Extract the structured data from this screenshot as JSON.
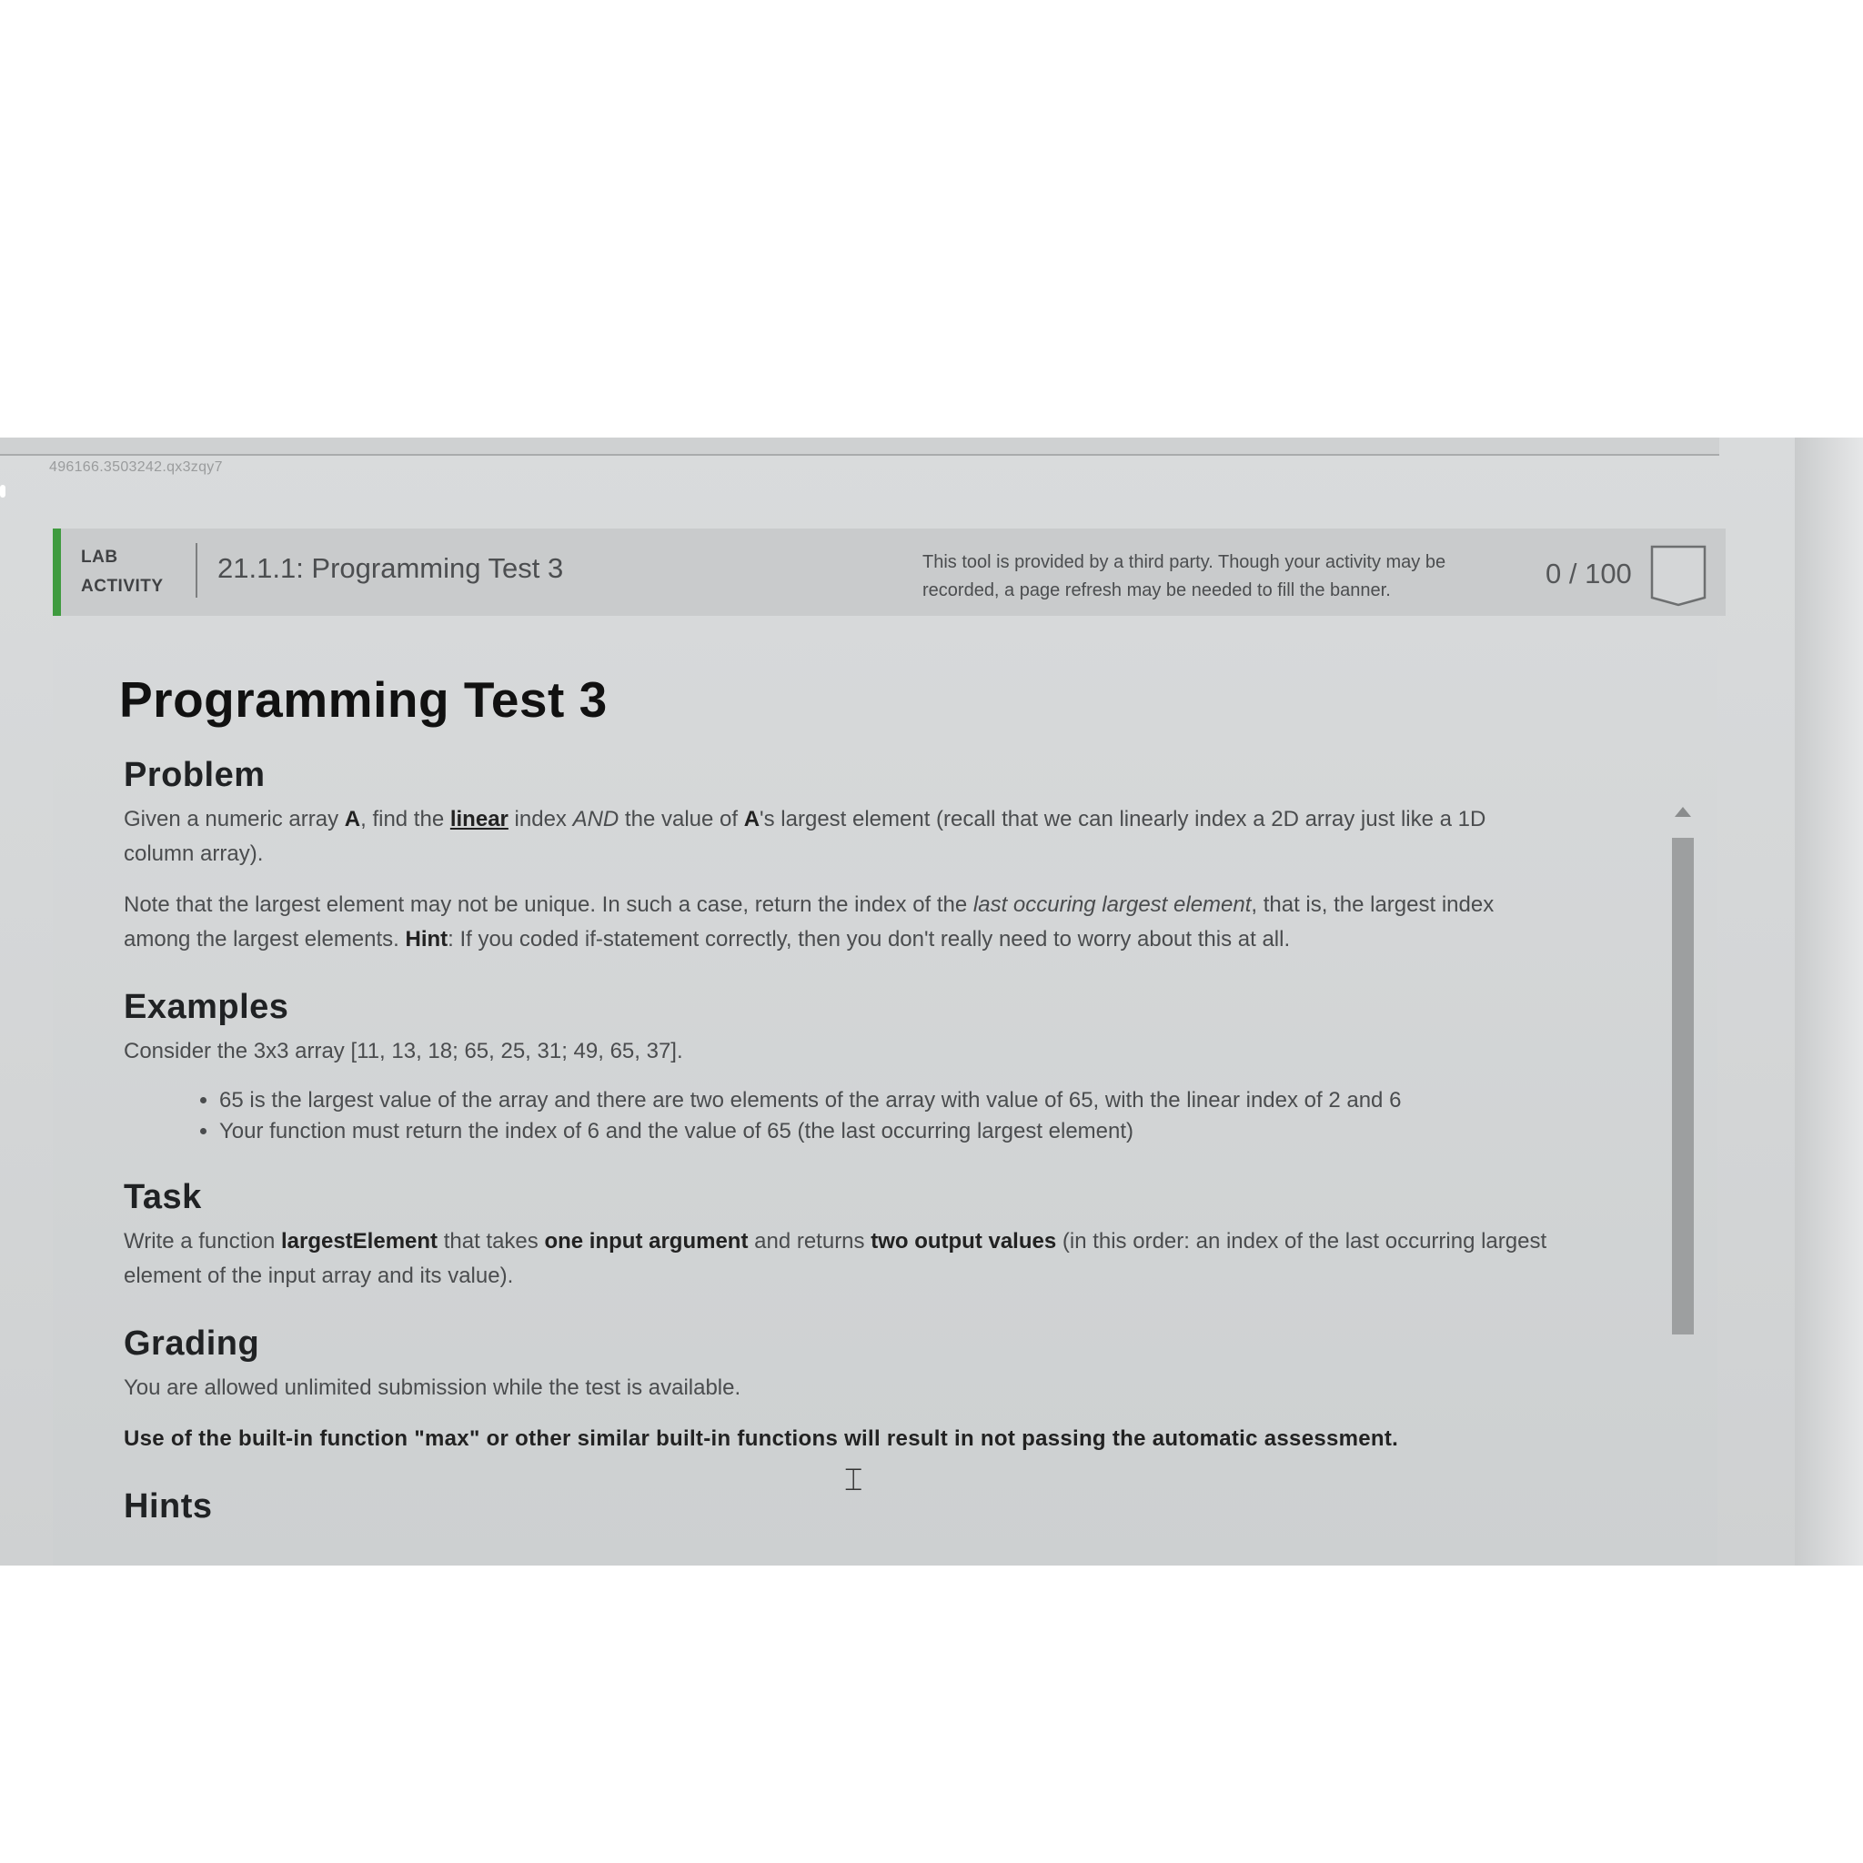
{
  "session_id": "496166.3503242.qx3zqy7",
  "banner": {
    "lab_line1": "LAB",
    "lab_line2": "ACTIVITY",
    "activity_title": "21.1.1: Programming Test 3",
    "notice_line1": "This tool is provided by a third party. Though your activity may be",
    "notice_line2": "recorded, a page refresh may be needed to fill the banner.",
    "score": "0 / 100"
  },
  "content": {
    "title": "Programming Test 3",
    "problem": {
      "heading": "Problem",
      "p1": {
        "t1": "Given a numeric array ",
        "b1": "A",
        "t2": ", find the ",
        "b2": "linear",
        "t3": " index ",
        "i1": "AND",
        "t4": " the value of ",
        "b3": "A",
        "t5": "'s largest element (recall that we can linearly index a 2D array just like a 1D column array)."
      },
      "p2": {
        "t1": "Note that the largest element may not be unique. In such a case, return the index of the ",
        "i1": "last occuring largest element",
        "t2": ", that is, the largest index among the largest elements. ",
        "b1": "Hint",
        "t3": ": If you coded if-statement correctly, then you don't really need to worry about this at all."
      }
    },
    "examples": {
      "heading": "Examples",
      "intro": "Consider the 3x3 array [11, 13, 18; 65, 25, 31; 49, 65, 37].",
      "bullets": [
        "65 is the largest value of the array and there are two elements of the array with value of 65, with the linear index of 2 and 6",
        "Your function must return the index of 6 and the value of 65 (the last occurring largest element)"
      ]
    },
    "task": {
      "heading": "Task",
      "t1": "Write a function ",
      "b1": "largestElement",
      "t2": " that takes ",
      "b2": "one input argument",
      "t3": " and returns ",
      "b3": "two output values",
      "t4": " (in this order: an index of the last occurring largest element of the input array and its value)."
    },
    "grading": {
      "heading": "Grading",
      "text": "You are allowed unlimited submission while the test is available.",
      "warning": "Use of the built-in function \"max\" or other similar built-in functions will result in not passing the automatic assessment."
    },
    "hints": {
      "heading": "Hints"
    }
  },
  "icons": {
    "score_badge": "score-badge-icon",
    "cursor": "text-cursor-icon",
    "scroll_up": "scroll-up-arrow-icon"
  },
  "colors": {
    "accent": "#3f9b3f",
    "banner_bg": "#c9cbcc",
    "content_bg": "#d7d9da"
  }
}
